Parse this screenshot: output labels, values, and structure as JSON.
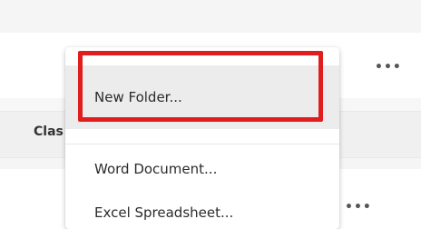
{
  "background": {
    "column_header_partial": "Clas"
  },
  "row_actions": {
    "more_label": "•••"
  },
  "context_menu": {
    "items": [
      {
        "label": "New Folder..."
      },
      {
        "label": "Word Document..."
      },
      {
        "label": "Excel Spreadsheet..."
      }
    ]
  },
  "colors": {
    "highlight": "#e01e1e",
    "hover_bg": "#ececec"
  }
}
